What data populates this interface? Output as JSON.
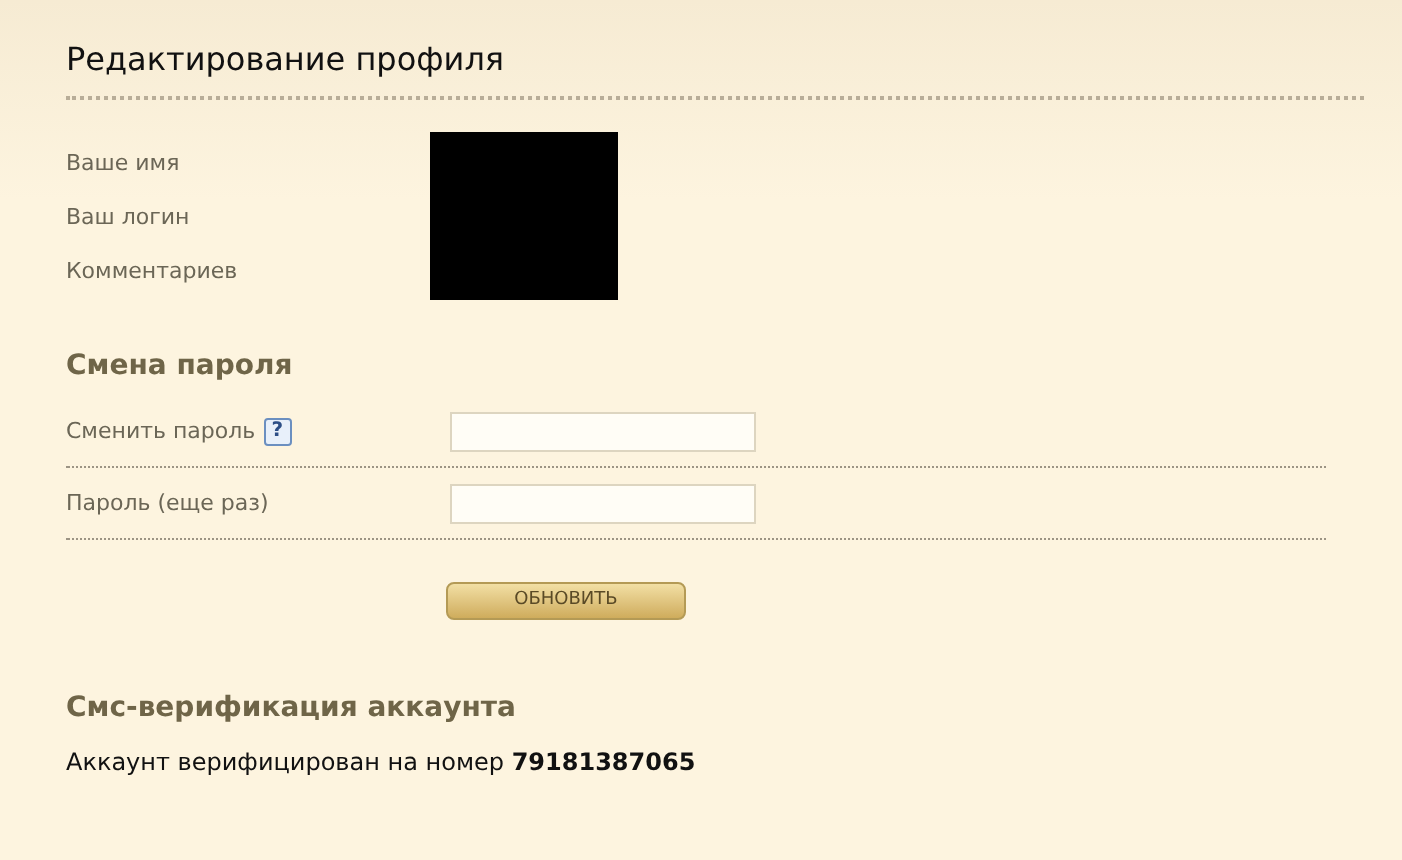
{
  "title": "Редактирование профиля",
  "profile_rows": [
    {
      "label": "Ваше имя"
    },
    {
      "label": "Ваш логин"
    },
    {
      "label": "Комментариев"
    }
  ],
  "password_section": {
    "heading": "Смена пароля",
    "fields": [
      {
        "label": "Сменить пароль",
        "help": "?"
      },
      {
        "label": "Пароль (еще раз)"
      }
    ],
    "button": "ОБНОВИТЬ"
  },
  "sms_section": {
    "heading": "Смс-верификация аккаунта",
    "text": "Аккаунт верифицирован на номер **79181387065**"
  }
}
